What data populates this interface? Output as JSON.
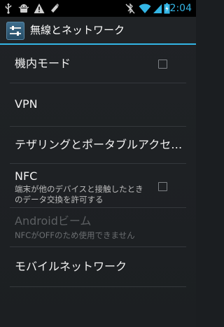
{
  "status_bar": {
    "time": "2:04",
    "icons": [
      "usb-icon",
      "android-debug-icon",
      "warning-icon",
      "sync-icon",
      "bluetooth-off-icon",
      "wifi-icon",
      "battery-icon",
      "signal-icon"
    ]
  },
  "action_bar": {
    "title": "無線とネットワーク",
    "icon": "settings-app-icon"
  },
  "settings": [
    {
      "id": "airplane-mode",
      "label": "機内モード",
      "summary": "",
      "checkbox": true,
      "checked": false,
      "enabled": true
    },
    {
      "id": "vpn",
      "label": "VPN",
      "summary": "",
      "checkbox": false,
      "enabled": true
    },
    {
      "id": "tethering",
      "label": "テザリングとポータブルアクセ…",
      "summary": "",
      "checkbox": false,
      "enabled": true
    },
    {
      "id": "nfc",
      "label": "NFC",
      "summary": "端末が他のデバイスと接触したときのデータ交換を許可する",
      "checkbox": true,
      "checked": false,
      "enabled": true
    },
    {
      "id": "android-beam",
      "label": "Androidビーム",
      "summary": "NFCがOFFのため使用できません",
      "checkbox": false,
      "enabled": false
    },
    {
      "id": "mobile-network",
      "label": "モバイルネットワーク",
      "summary": "",
      "checkbox": false,
      "enabled": true
    }
  ]
}
